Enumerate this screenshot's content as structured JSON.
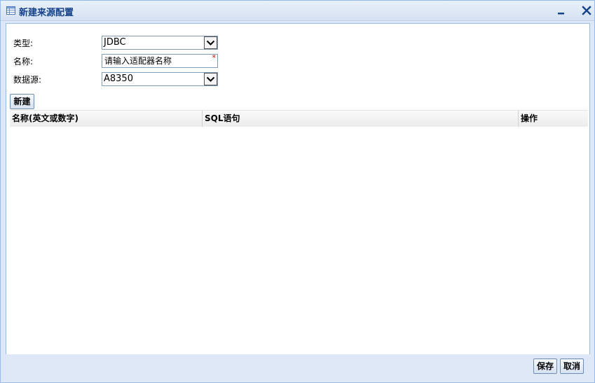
{
  "window": {
    "title": "新建来源配置",
    "icons": {
      "title": "table-icon",
      "minimize": "minimize-icon",
      "close": "close-icon",
      "dropdown": "chevron-down-icon"
    }
  },
  "form": {
    "type_label": "类型:",
    "type_value": "JDBC",
    "name_label": "名称:",
    "name_placeholder": "请输入适配器名称",
    "required_mark": "*",
    "datasource_label": "数据源:",
    "datasource_value": "A8350"
  },
  "toolbar": {
    "new_label": "新建"
  },
  "grid": {
    "columns": [
      "名称(英文或数字)",
      "SQL语句",
      "操作"
    ],
    "rows": []
  },
  "footer": {
    "save_label": "保存",
    "cancel_label": "取消"
  },
  "colors": {
    "title_text": "#15428b",
    "frame": "#dfe8f6",
    "border": "#99bbe8",
    "required": "#dd0000"
  }
}
